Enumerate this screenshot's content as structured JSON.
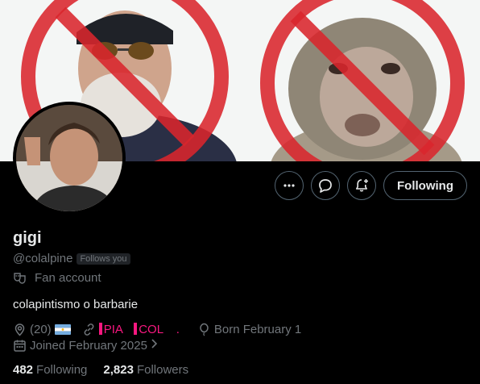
{
  "profile": {
    "display_name": "gigi",
    "handle": "@colalpine",
    "follows_you_badge": "Follows you",
    "category": "Fan account",
    "bio": "colapintismo o barbarie",
    "location": "(20)",
    "link_pia": "PIA",
    "link_col": "COL",
    "link_dot": ".",
    "birthday": "Born February 1",
    "joined": "Joined February 2025",
    "following_count": "482",
    "following_label": "Following",
    "followers_count": "2,823",
    "followers_label": "Followers"
  },
  "actions": {
    "more_icon": "more-icon",
    "message_icon": "message-icon",
    "notify_icon": "bell-plus-icon",
    "follow_button_label": "Following"
  },
  "icons": {
    "category": "masks-icon",
    "location": "location-pin-icon",
    "link": "link-icon",
    "birthday": "balloon-icon",
    "joined": "calendar-icon"
  },
  "colors": {
    "background": "#000000",
    "text_primary": "#e7e9ea",
    "text_secondary": "#71767b",
    "accent_pink": "#f91880",
    "border": "#536471",
    "prohibition_red": "#d9262c"
  }
}
